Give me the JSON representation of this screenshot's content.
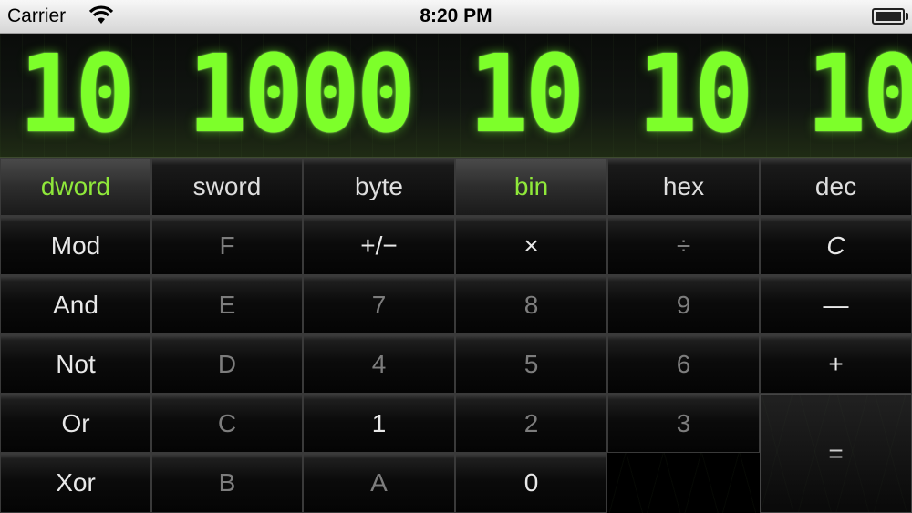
{
  "status_bar": {
    "carrier": "Carrier",
    "time": "8:20 PM"
  },
  "display": {
    "value": "10 1000 10 10 10"
  },
  "modes": {
    "dword": "dword",
    "sword": "sword",
    "byte": "byte",
    "bin": "bin",
    "hex": "hex",
    "dec": "dec"
  },
  "keys": {
    "mod": "Mod",
    "f": "F",
    "plus_minus": "+/−",
    "multiply": "×",
    "divide": "÷",
    "clear": "C",
    "and": "And",
    "e": "E",
    "seven": "7",
    "eight": "8",
    "nine": "9",
    "minus": "—",
    "not": "Not",
    "d": "D",
    "four": "4",
    "five": "5",
    "six": "6",
    "plus": "+",
    "or": "Or",
    "c": "C",
    "one": "1",
    "two": "2",
    "three": "3",
    "equals": "=",
    "xor": "Xor",
    "b": "B",
    "a": "A",
    "zero": "0"
  }
}
